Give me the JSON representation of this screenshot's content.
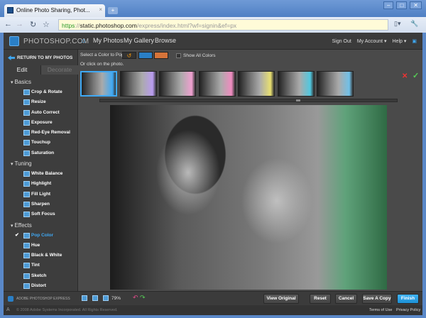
{
  "browser": {
    "tab_title": "Online Photo Sharing, Phot...",
    "url_scheme": "https",
    "url_domain": "static.photoshop.com",
    "url_path": "/express/index.html?wf=signin&ef=px"
  },
  "header": {
    "logo": "PHOTOSHOP.COM",
    "nav": [
      "My Photos",
      "My Gallery",
      "Browse"
    ],
    "sign_out": "Sign Out",
    "my_account": "My Account",
    "help": "Help"
  },
  "sidebar": {
    "return_label": "RETURN TO MY PHOTOS",
    "tabs": [
      "Edit",
      "Decorate"
    ],
    "sections": [
      {
        "title": "Basics",
        "items": [
          "Crop & Rotate",
          "Resize",
          "Auto Correct",
          "Exposure",
          "Red-Eye Removal",
          "Touchup",
          "Saturation"
        ]
      },
      {
        "title": "Tuning",
        "items": [
          "White Balance",
          "Highlight",
          "Fill Light",
          "Sharpen",
          "Soft Focus"
        ]
      },
      {
        "title": "Effects",
        "items": [
          "Pop Color",
          "Hue",
          "Black & White",
          "Tint",
          "Sketch",
          "Distort"
        ]
      }
    ],
    "active_item": "Pop Color"
  },
  "options": {
    "select_label": "Select a Color to Pop:",
    "show_all": "Show All Colors",
    "click_hint": "Or click on the photo.",
    "swatches": [
      "#2a7fc6",
      "#d6743a"
    ]
  },
  "thumbnail_tints": [
    "#3fa9f5",
    "#b99cf0",
    "#f0a0d0",
    "#f08cc0",
    "#e8e070",
    "#50c8e0",
    "#70c0e8"
  ],
  "bottom": {
    "product": "ADOBE PHOTOSHOP EXPRESS",
    "zoom": "79%",
    "view_original": "View Original",
    "reset": "Reset",
    "cancel": "Cancel",
    "save_copy": "Save A Copy",
    "finish": "Finish"
  },
  "footer": {
    "copyright": "© 2008 Adobe Systems Incorporated. All Rights Reserved.",
    "terms": "Terms of Use",
    "privacy": "Privacy Policy"
  }
}
